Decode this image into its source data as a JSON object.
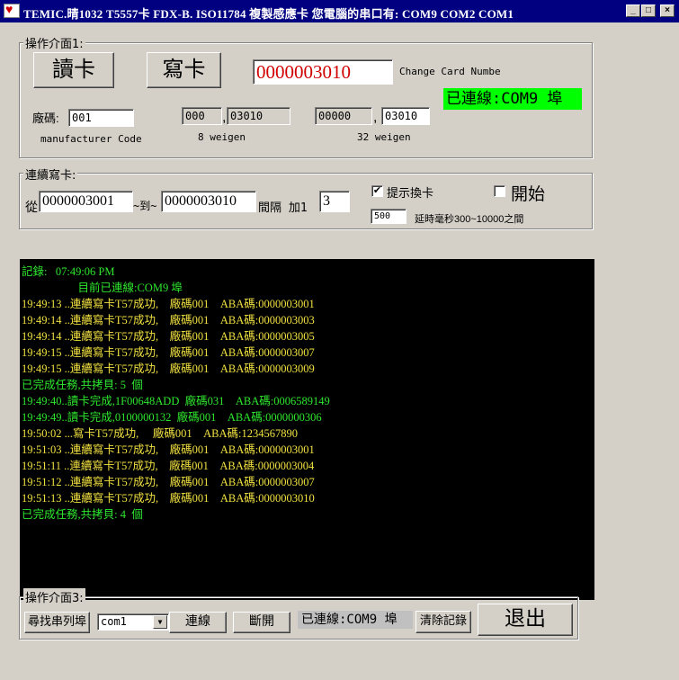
{
  "window": {
    "title": "TEMIC.晴1032   T5557卡  FDX-B.  ISO11784   複製感應卡    您電腦的串口有: COM9  COM2  COM1",
    "minimize": "_",
    "maximize": "□",
    "close": "×"
  },
  "panel1": {
    "title": "操作介面1:",
    "read_button": "讀卡",
    "write_button": "寫卡",
    "card_number": "0000003010",
    "change_label": "Change Card Numbe",
    "connection_status": "已連線:COM9 埠",
    "vendor_label": "廠碼:",
    "vendor_value": "001",
    "manufacturer_label": "manufacturer Code",
    "w8_part1": "000",
    "w8_part2": "03010",
    "w8_label": "8 weigen",
    "w32_part1": "00000",
    "w32_part2": "03010",
    "w32_label": "32 weigen",
    "comma": ","
  },
  "panel2": {
    "title": "連續寫卡:",
    "from_label": "從",
    "from_value": "0000003001",
    "to_label": "~到~",
    "to_value": "0000003010",
    "interval_label": "間隔 加1",
    "interval_value": "3",
    "prompt_label": "提示換卡",
    "prompt_checked": "✔",
    "start_label": "開始",
    "delay_value": "500",
    "delay_label": "延時毫秒300~10000之間"
  },
  "log": {
    "lines": [
      {
        "text": "記錄:   07:49:06 PM",
        "color": "#2ee62e"
      },
      {
        "text": "                    目前已連線:COM9 埠",
        "color": "#2ee62e"
      },
      {
        "text": "19:49:13 ..連續寫卡T57成功,    廠碼001    ABA碼:0000003001",
        "color": "#f0e040"
      },
      {
        "text": "19:49:14 ..連續寫卡T57成功,    廠碼001    ABA碼:0000003003",
        "color": "#f0e040"
      },
      {
        "text": "19:49:14 ..連續寫卡T57成功,    廠碼001    ABA碼:0000003005",
        "color": "#f0e040"
      },
      {
        "text": "19:49:15 ..連續寫卡T57成功,    廠碼001    ABA碼:0000003007",
        "color": "#f0e040"
      },
      {
        "text": "19:49:15 ..連續寫卡T57成功,    廠碼001    ABA碼:0000003009",
        "color": "#f0e040"
      },
      {
        "text": "已完成任務,共拷貝: 5  個",
        "color": "#2ee62e"
      },
      {
        "text": "19:49:40..讀卡完成,1F00648ADD  廠碼031    ABA碼:0006589149",
        "color": "#2ee62e"
      },
      {
        "text": "19:49:49..讀卡完成,0100000132  廠碼001    ABA碼:0000000306",
        "color": "#2ee62e"
      },
      {
        "text": "19:50:02 ...寫卡T57成功,     廠碼001    ABA碼:1234567890",
        "color": "#f0e040"
      },
      {
        "text": "19:51:03 ..連續寫卡T57成功,    廠碼001    ABA碼:0000003001",
        "color": "#f0e040"
      },
      {
        "text": "19:51:11 ..連續寫卡T57成功,    廠碼001    ABA碼:0000003004",
        "color": "#f0e040"
      },
      {
        "text": "19:51:12 ..連續寫卡T57成功,    廠碼001    ABA碼:0000003007",
        "color": "#f0e040"
      },
      {
        "text": "19:51:13 ..連續寫卡T57成功,    廠碼001    ABA碼:0000003010",
        "color": "#f0e040"
      },
      {
        "text": "已完成任務,共拷貝: 4  個",
        "color": "#2ee62e"
      }
    ]
  },
  "panel3": {
    "title": "操作介面3:",
    "find_ports_button": "尋找串列埠",
    "port_select": "com1",
    "connect_button": "連線",
    "disconnect_button": "斷開",
    "status": "已連線:COM9 埠",
    "clear_button": "清除記錄",
    "exit_button": "退出"
  },
  "colors": {
    "titlebar": "#000080",
    "status_green": "#00ff00",
    "card_number_red": "#d00000",
    "log_background": "#000000"
  }
}
